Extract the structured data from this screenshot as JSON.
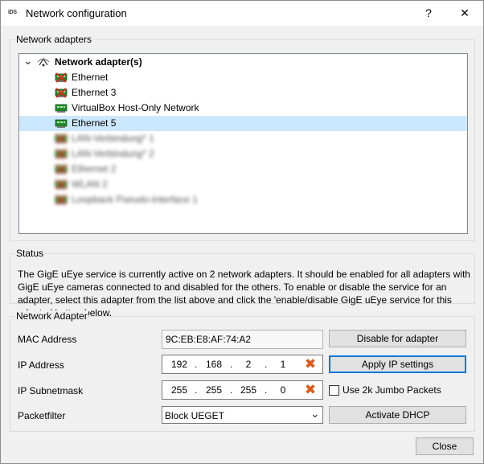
{
  "window": {
    "title": "Network configuration",
    "app_icon_text": "iDS",
    "help_label": "?",
    "close_label": "✕"
  },
  "adapters_group": {
    "label": "Network adapters",
    "tree": {
      "expander": "⌄",
      "root_label": "Network adapter(s)",
      "items": [
        {
          "label": "Ethernet",
          "status": "disabled",
          "blurred": false,
          "selected": false
        },
        {
          "label": "Ethernet 3",
          "status": "disabled",
          "blurred": false,
          "selected": false
        },
        {
          "label": "VirtualBox Host-Only Network",
          "status": "enabled",
          "blurred": false,
          "selected": false
        },
        {
          "label": "Ethernet 5",
          "status": "enabled",
          "blurred": false,
          "selected": true
        },
        {
          "label": "LAN-Verbindung* 1",
          "status": "disabled",
          "blurred": true,
          "selected": false
        },
        {
          "label": "LAN-Verbindung* 2",
          "status": "disabled",
          "blurred": true,
          "selected": false
        },
        {
          "label": "Ethernet 2",
          "status": "disabled",
          "blurred": true,
          "selected": false
        },
        {
          "label": "WLAN 2",
          "status": "disabled",
          "blurred": true,
          "selected": false
        },
        {
          "label": "Loopback Pseudo-Interface 1",
          "status": "disabled",
          "blurred": true,
          "selected": false
        }
      ]
    }
  },
  "status_group": {
    "label": "Status",
    "text": "The GigE uEye service is currently active on 2 network adapters. It should be enabled for all adapters with GigE uEye cameras connected to and disabled for the others. To enable or disable the service for an adapter, select this adapter from the list above and click the 'enable/disable GigE uEye service for this adapter' button below."
  },
  "adapter_group": {
    "label": "Network Adapter",
    "mac_label": "MAC Address",
    "mac_value": "9C:EB:E8:AF:74:A2",
    "ip_label": "IP Address",
    "ip": [
      "192",
      "168",
      "2",
      "1"
    ],
    "subnet_label": "IP Subnetmask",
    "subnet": [
      "255",
      "255",
      "255",
      "0"
    ],
    "ip_dot": ".",
    "clear_glyph": "✖",
    "packetfilter_label": "Packetfilter",
    "packetfilter_value": "Block UEGET",
    "dropdown_glyph": "⌄",
    "disable_button": "Disable for adapter",
    "apply_button": "Apply IP settings",
    "jumbo_label": "Use 2k Jumbo Packets",
    "jumbo_checked": false,
    "dhcp_button": "Activate DHCP"
  },
  "footer": {
    "close_button": "Close"
  },
  "colors": {
    "selected_row": "#cce8ff",
    "default_button_border": "#0078d7",
    "clear_icon": "#e05a1c",
    "enabled_icon": "#1f8a2a",
    "disabled_icon_cross": "#d62a1a"
  }
}
